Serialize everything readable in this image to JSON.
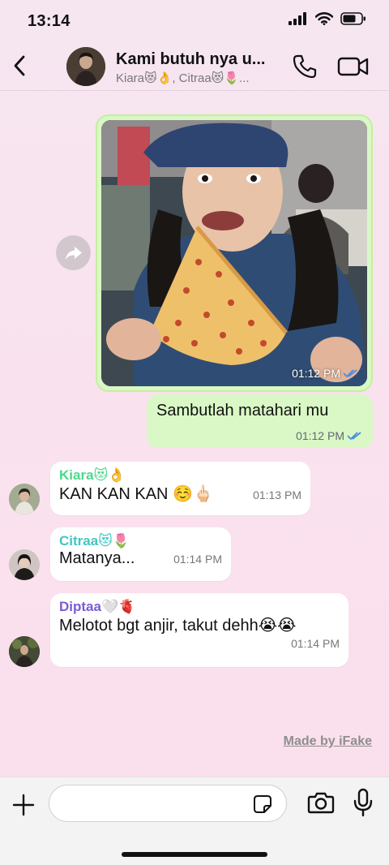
{
  "status": {
    "time": "13:14"
  },
  "header": {
    "title": "Kami butuh nya u...",
    "members": "Kiara😻👌, Citraa😻🌷..."
  },
  "messages": {
    "photo": {
      "time": "01:12 PM"
    },
    "outgoing": {
      "text": "Sambutlah matahari mu",
      "time": "01:12 PM"
    },
    "m1": {
      "sender": "Kiara😻👌",
      "sender_color": "#4cd98a",
      "text": "KAN KAN KAN ☺️🖕🏻",
      "time": "01:13 PM"
    },
    "m2": {
      "sender": "Citraa😻🌷",
      "sender_color": "#40c7c3",
      "text": "Matanya...",
      "time": "01:14 PM"
    },
    "m3": {
      "sender": "Diptaa🤍🫀",
      "sender_color": "#7b5bd6",
      "text": "Melotot bgt anjir, takut dehh😭😭",
      "time": "01:14 PM"
    }
  },
  "watermark": "Made by iFake",
  "input": {
    "placeholder": ""
  },
  "colors": {
    "outgoing_bubble": "#d9f8c5",
    "incoming_bubble": "#ffffff",
    "read_ticks": "#4a8de0"
  }
}
